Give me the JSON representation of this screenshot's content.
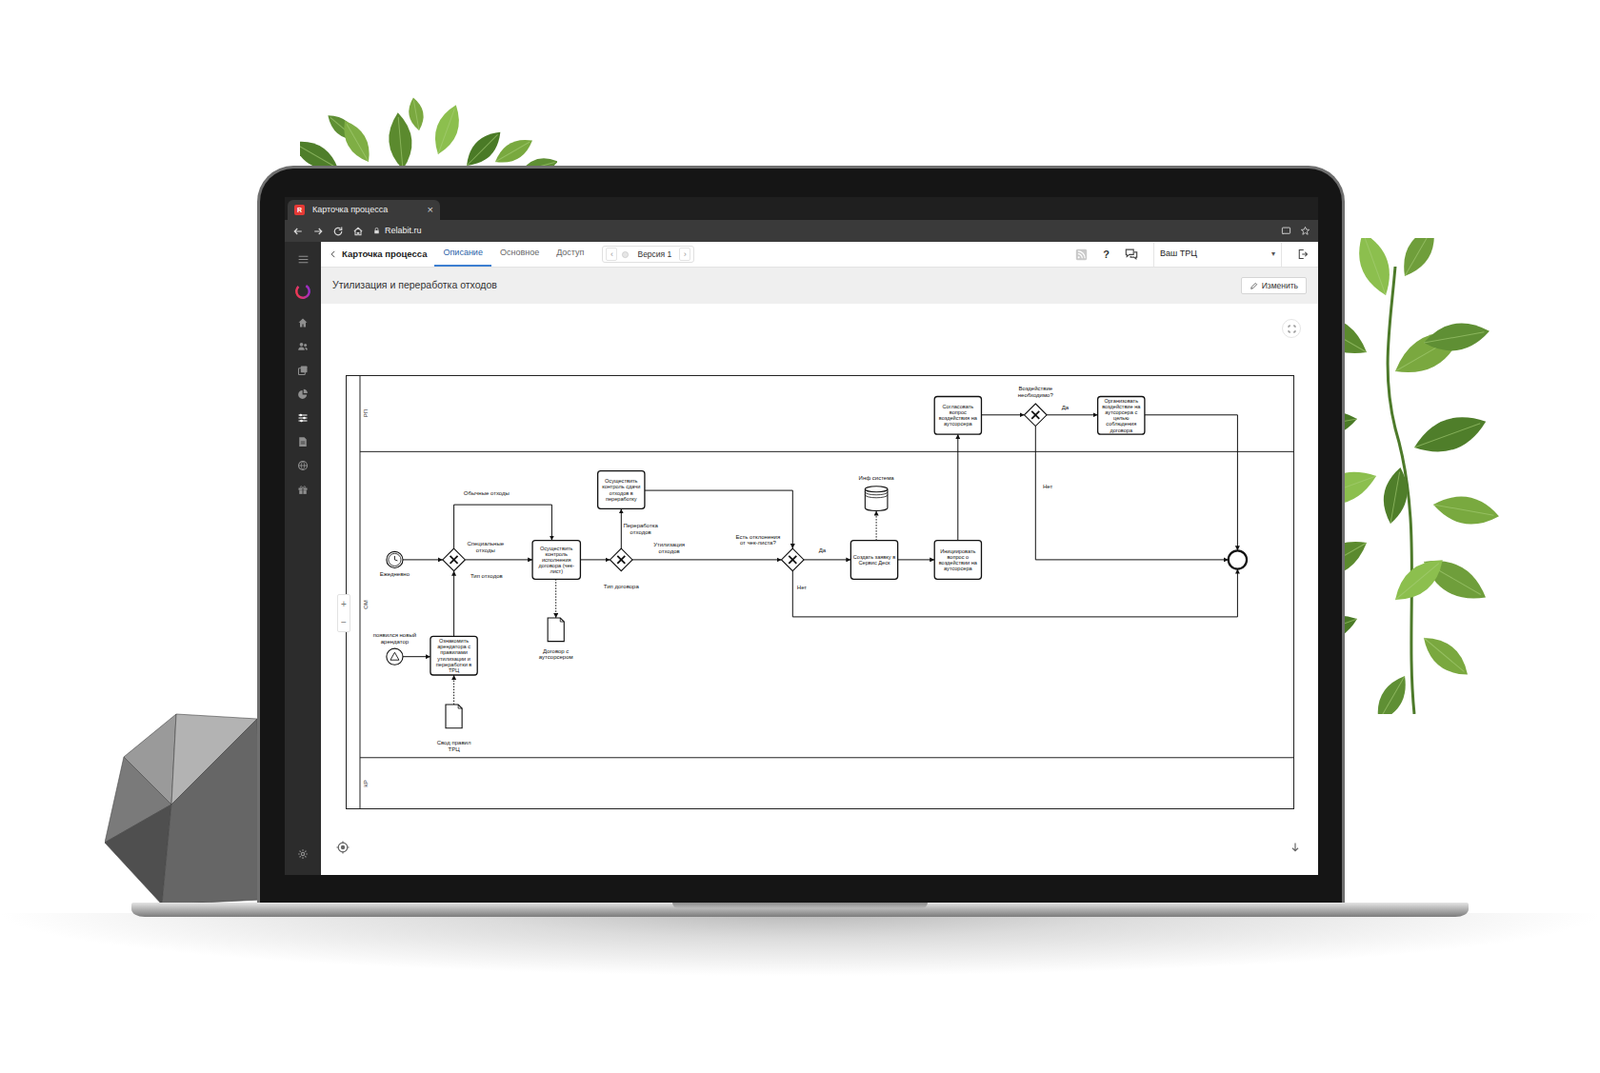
{
  "browser": {
    "tab": {
      "favicon": "R",
      "title": "Карточка процесса",
      "close": "×"
    },
    "url": "Relabit.ru"
  },
  "sidebar": {
    "items": [
      {
        "selected": false
      },
      {
        "selected": false
      },
      {
        "selected": false
      },
      {
        "selected": false
      },
      {
        "selected": true
      },
      {
        "selected": false
      },
      {
        "selected": false
      },
      {
        "selected": false
      }
    ]
  },
  "header": {
    "title": "Карточка процесса",
    "tabs": [
      {
        "label": "Описание",
        "selected": true
      },
      {
        "label": "Основное",
        "selected": false
      },
      {
        "label": "Доступ",
        "selected": false
      }
    ],
    "version": {
      "prev": "‹",
      "label": "Версия 1",
      "next": "›"
    },
    "help": "?",
    "org": {
      "label": "Ваш ТРЦ",
      "caret": "▾"
    }
  },
  "process": {
    "title": "Утилизация и переработка отходов",
    "edit_button": "Изменить"
  },
  "zoom": {
    "in": "+",
    "out": "−"
  },
  "diagram": {
    "lanes": [
      {
        "label": "РП"
      },
      {
        "label": "ОМ"
      },
      {
        "label": "КР"
      }
    ],
    "nodes": [
      {
        "kind": "timer-start",
        "label": "Ежедневно"
      },
      {
        "kind": "gateway",
        "label": "Тип отходов"
      },
      {
        "kind": "task",
        "label": "Осуществить контроль исполнения договора (чек-лист)"
      },
      {
        "kind": "document",
        "label": "Договор с аутсорсером"
      },
      {
        "kind": "gateway",
        "label": "Тип договора"
      },
      {
        "kind": "task",
        "label": "Осуществить контроль сдачи отходов в переработку"
      },
      {
        "kind": "gateway",
        "label": "Есть отклонения от чек-листа?"
      },
      {
        "kind": "data-store",
        "label": "Инф система"
      },
      {
        "kind": "task",
        "label": "Создать заявку в Сервис Деск"
      },
      {
        "kind": "task",
        "label": "Инициировать вопрос о воздействии на аутсорсера"
      },
      {
        "kind": "task",
        "label": "Согласовать вопрос воздействия на аутсорсера"
      },
      {
        "kind": "gateway",
        "label": "Воздействие необходимо?"
      },
      {
        "kind": "task",
        "label": "Организовать воздействие на аутсорсера с целью соблюдения договора"
      },
      {
        "kind": "end"
      },
      {
        "kind": "message-start",
        "label": "появился новый арендатор"
      },
      {
        "kind": "task",
        "label": "Ознакомить арендатора с правилами утилизации и переработки в ТРЦ"
      },
      {
        "kind": "document",
        "label": "Свод правил ТРЦ"
      }
    ],
    "flow_labels": [
      {
        "text": "Обычные отходы"
      },
      {
        "text": "Специальные отходы"
      },
      {
        "text": "Переработка отходов"
      },
      {
        "text": "Утилизация отходов"
      },
      {
        "text": "Да"
      },
      {
        "text": "Нет"
      },
      {
        "text": "Да"
      },
      {
        "text": "Нет"
      }
    ]
  }
}
